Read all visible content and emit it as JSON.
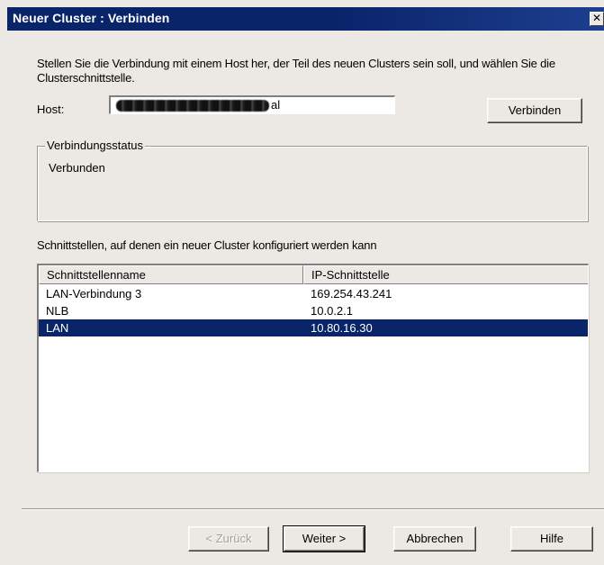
{
  "window": {
    "title": "Neuer Cluster : Verbinden",
    "close_glyph": "✕"
  },
  "intro_text": "Stellen Sie die Verbindung mit einem Host her, der Teil des neuen Clusters sein soll, und wählen Sie die Clusterschnittstelle.",
  "host": {
    "label": "Host:",
    "value_visible_suffix": "al",
    "connect_button": "Verbinden"
  },
  "connection_status": {
    "legend": "Verbindungsstatus",
    "status": "Verbunden"
  },
  "interfaces": {
    "caption": "Schnittstellen, auf denen ein neuer Cluster konfiguriert werden kann",
    "columns": [
      "Schnittstellenname",
      "IP-Schnittstelle"
    ],
    "rows": [
      {
        "name": "LAN-Verbindung 3",
        "ip": "169.254.43.241",
        "selected": false
      },
      {
        "name": "NLB",
        "ip": "10.0.2.1",
        "selected": false
      },
      {
        "name": "LAN",
        "ip": "10.80.16.30",
        "selected": true
      }
    ],
    "selection_color": "#0a246a"
  },
  "buttons": {
    "back": "< Zurück",
    "next": "Weiter >",
    "cancel": "Abbrechen",
    "help": "Hilfe"
  },
  "colors": {
    "title_bar": "#0a246a",
    "dialog_bg": "#ece9e4"
  },
  "icons": {
    "close": "close-icon"
  }
}
